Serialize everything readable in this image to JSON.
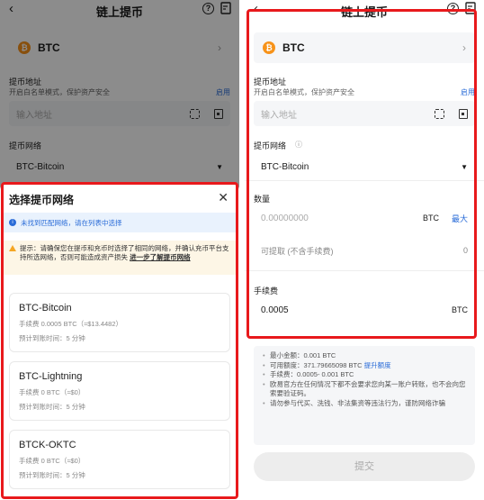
{
  "header": {
    "back_icon": "‹",
    "title": "链上提币",
    "help_icon": "?",
    "record_icon": "records"
  },
  "coin": {
    "symbol": "BTC",
    "badge": "₿"
  },
  "address": {
    "label": "提币地址",
    "sub": "开启白名单模式，保护资产安全",
    "link": "启用",
    "placeholder": "输入地址"
  },
  "network": {
    "label": "提币网络",
    "info_icon": "ⓘ",
    "value": "BTC-Bitcoin",
    "caret": "▼"
  },
  "sheet": {
    "title": "选择提币网络",
    "close": "✕",
    "info_text": "未找到匹配网络，请在列表中选择",
    "warn_text": "提示：请确保您在提币和充币时选择了相同的网络，并确认充币平台支持所选网络，否则可能造成资产损失",
    "warn_more": "进一步了解提币网络",
    "networks": [
      {
        "name": "BTC-Bitcoin",
        "fee": "手续费 0.0005 BTC（≈$13.4482）",
        "time": "预计到账时间：5 分钟"
      },
      {
        "name": "BTC-Lightning",
        "fee": "手续费 0 BTC（≈$0）",
        "time": "预计到账时间：5 分钟"
      },
      {
        "name": "BTCK-OKTC",
        "fee": "手续费 0 BTC（≈$0）",
        "time": "预计到账时间：5 分钟"
      }
    ]
  },
  "amount": {
    "label": "数量",
    "placeholder": "0.00000000",
    "unit": "BTC",
    "max": "最大",
    "avail_label": "可提取 (不含手续费)",
    "avail_value": "0"
  },
  "fee": {
    "label": "手续费",
    "value": "0.0005",
    "unit": "BTC"
  },
  "notes": {
    "min": "最小金额：0.001 BTC",
    "quota_prefix": "可用额度：371.79665098 BTC",
    "quota_link": "提升额度",
    "fee_range": "手续费：0.0005- 0.001 BTC",
    "warn1": "欧易官方在任何情况下都不会要求您向某一账户转账，也不会向您索要验证码。",
    "warn2": "请勿参与代买、洗钱、非法集资等违法行为，谨防网络诈骗"
  },
  "submit": "提交",
  "highlight_color": "#e8191c"
}
